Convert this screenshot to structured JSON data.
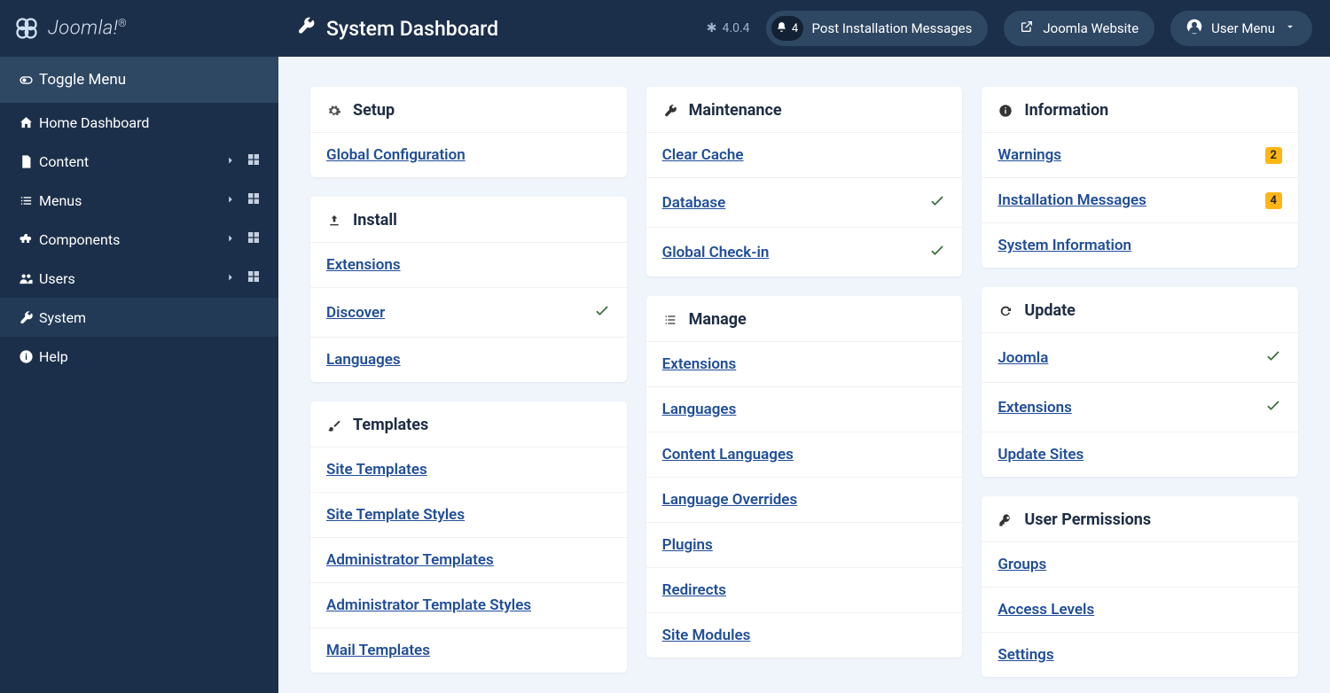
{
  "brand": "Joomla!",
  "page_title": "System Dashboard",
  "version": "4.0.4",
  "topbar": {
    "notif_count": "4",
    "post_install": "Post Installation Messages",
    "website": "Joomla Website",
    "user_menu": "User Menu"
  },
  "sidebar": {
    "toggle": "Toggle Menu",
    "items": [
      {
        "label": "Home Dashboard",
        "id": "home",
        "expand": false,
        "has_dash": false
      },
      {
        "label": "Content",
        "id": "content",
        "expand": true,
        "has_dash": true
      },
      {
        "label": "Menus",
        "id": "menus",
        "expand": true,
        "has_dash": true
      },
      {
        "label": "Components",
        "id": "components",
        "expand": true,
        "has_dash": true
      },
      {
        "label": "Users",
        "id": "users",
        "expand": true,
        "has_dash": true
      },
      {
        "label": "System",
        "id": "system",
        "expand": false,
        "has_dash": false,
        "active": true
      },
      {
        "label": "Help",
        "id": "help",
        "expand": false,
        "has_dash": false
      }
    ]
  },
  "columns": [
    [
      {
        "title": "Setup",
        "icon": "gear",
        "items": [
          {
            "label": "Global Configuration"
          }
        ]
      },
      {
        "title": "Install",
        "icon": "upload",
        "items": [
          {
            "label": "Extensions"
          },
          {
            "label": "Discover",
            "check": true
          },
          {
            "label": "Languages"
          }
        ]
      },
      {
        "title": "Templates",
        "icon": "brush",
        "items": [
          {
            "label": "Site Templates"
          },
          {
            "label": "Site Template Styles"
          },
          {
            "label": "Administrator Templates"
          },
          {
            "label": "Administrator Template Styles"
          },
          {
            "label": "Mail Templates"
          }
        ]
      }
    ],
    [
      {
        "title": "Maintenance",
        "icon": "wrench",
        "items": [
          {
            "label": "Clear Cache"
          },
          {
            "label": "Database",
            "check": true
          },
          {
            "label": "Global Check-in",
            "check": true
          }
        ]
      },
      {
        "title": "Manage",
        "icon": "list",
        "items": [
          {
            "label": "Extensions"
          },
          {
            "label": "Languages"
          },
          {
            "label": "Content Languages"
          },
          {
            "label": "Language Overrides"
          },
          {
            "label": "Plugins"
          },
          {
            "label": "Redirects"
          },
          {
            "label": "Site Modules"
          }
        ]
      }
    ],
    [
      {
        "title": "Information",
        "icon": "info",
        "items": [
          {
            "label": "Warnings",
            "badge": "2"
          },
          {
            "label": "Installation Messages",
            "badge": "4"
          },
          {
            "label": "System Information"
          }
        ]
      },
      {
        "title": "Update",
        "icon": "refresh",
        "items": [
          {
            "label": "Joomla",
            "check": true
          },
          {
            "label": "Extensions",
            "check": true
          },
          {
            "label": "Update Sites"
          }
        ]
      },
      {
        "title": "User Permissions",
        "icon": "key",
        "items": [
          {
            "label": "Groups"
          },
          {
            "label": "Access Levels"
          },
          {
            "label": "Settings"
          }
        ]
      }
    ]
  ]
}
